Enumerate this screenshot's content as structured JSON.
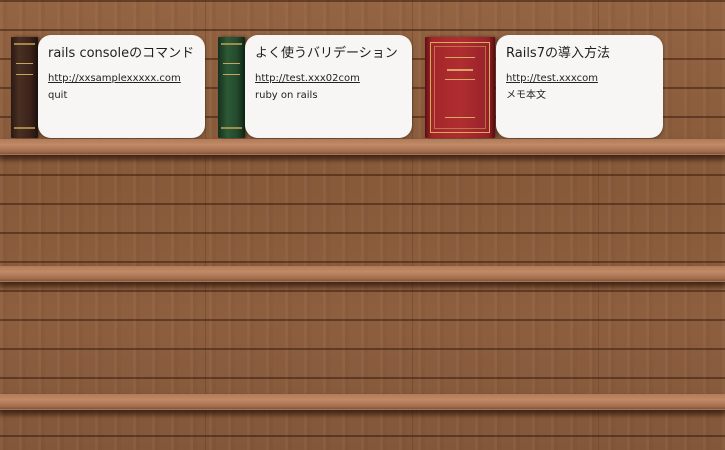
{
  "colors": {
    "card_background": "#f7f6f4",
    "wood": "#8a5c3c",
    "shelf": "#b07a58"
  },
  "bookmarks": [
    {
      "title": "rails consoleのコマンド",
      "url": "http://xxsamplexxxxx.com",
      "memo": "quit",
      "book_icon": "dark-brown-book-spine"
    },
    {
      "title": "よく使うバリデーション",
      "url": "http://test.xxx02com",
      "memo": "ruby on rails",
      "book_icon": "green-book-spine"
    },
    {
      "title": "Rails7の導入方法",
      "url": "http://test.xxxcom",
      "memo": "メモ本文",
      "book_icon": "red-book-cover"
    }
  ]
}
